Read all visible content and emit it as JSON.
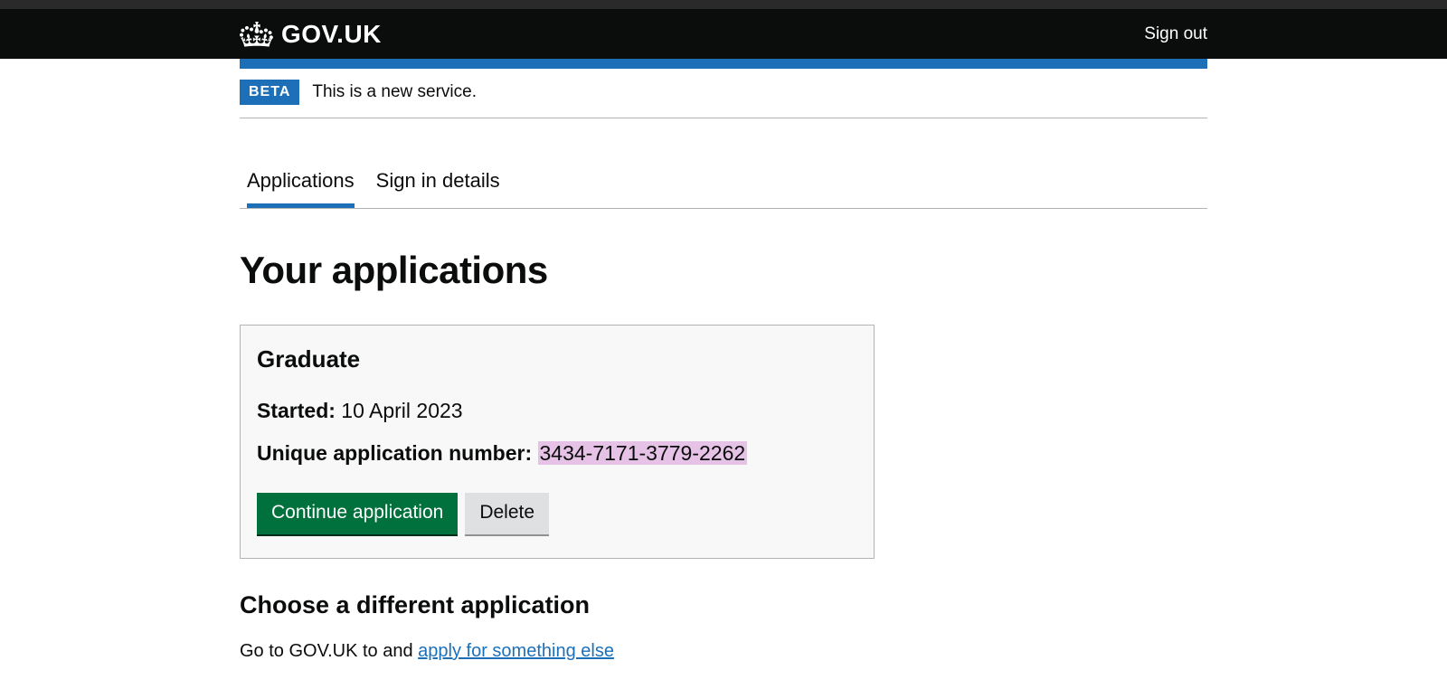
{
  "header": {
    "brand": "GOV.UK",
    "signout": "Sign out"
  },
  "phase": {
    "tag": "BETA",
    "text": "This is a new service."
  },
  "tabs": {
    "applications": "Applications",
    "signin_details": "Sign in details"
  },
  "page": {
    "title": "Your applications"
  },
  "application": {
    "type": "Graduate",
    "started_label": "Started:",
    "started_value": "10 April 2023",
    "uan_label": "Unique application number:",
    "uan_value": "3434-7171-3779-2262",
    "continue_label": "Continue application",
    "delete_label": "Delete"
  },
  "choose_different": {
    "heading": "Choose a different application",
    "prefix": "Go to GOV.UK to and ",
    "link": "apply for something else"
  }
}
